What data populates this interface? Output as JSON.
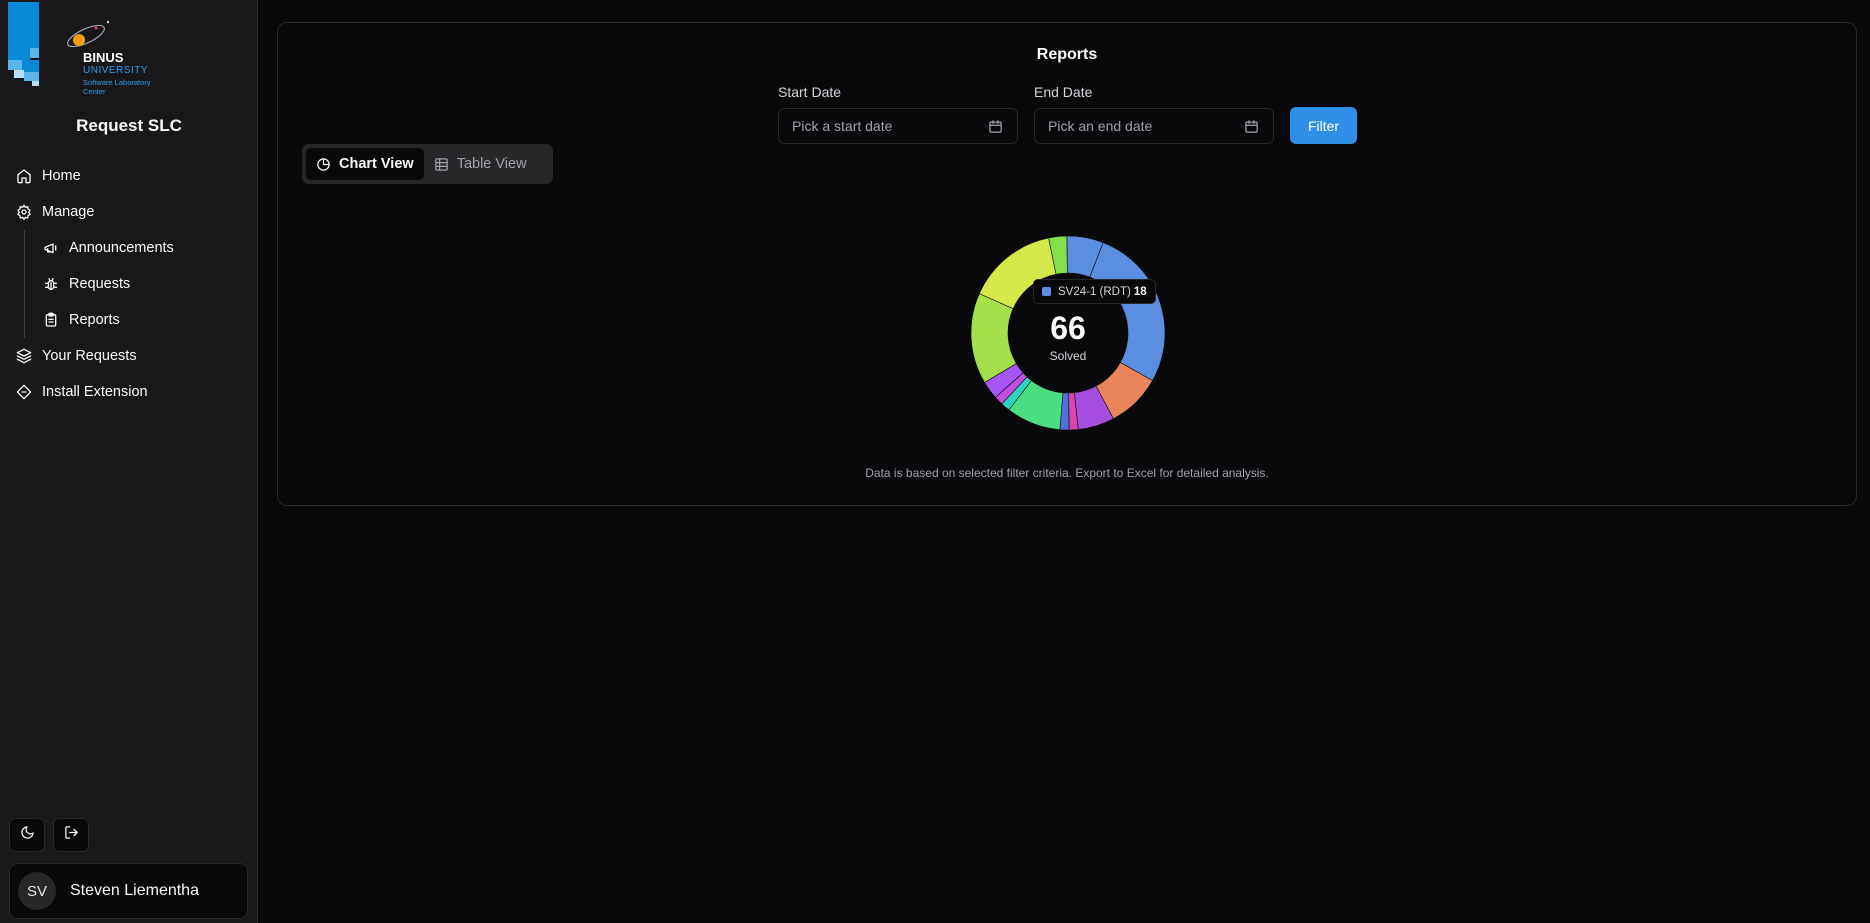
{
  "brand": {
    "logo_line1": "BINUS",
    "logo_line2": "UNIVERSITY",
    "logo_line3": "Software Laboratory",
    "logo_line4": "Center",
    "app_title": "Request SLC"
  },
  "sidebar": {
    "items": [
      {
        "label": "Home",
        "icon": "home-icon"
      },
      {
        "label": "Manage",
        "icon": "gear-icon"
      },
      {
        "label": "Announcements",
        "icon": "megaphone-icon"
      },
      {
        "label": "Requests",
        "icon": "bug-icon"
      },
      {
        "label": "Reports",
        "icon": "clipboard-icon"
      },
      {
        "label": "Your Requests",
        "icon": "layers-icon"
      },
      {
        "label": "Install Extension",
        "icon": "extension-icon"
      }
    ]
  },
  "user": {
    "initials": "SV",
    "name": "Steven Liementha"
  },
  "reports": {
    "title": "Reports",
    "start_label": "Start Date",
    "start_placeholder": "Pick a start date",
    "end_label": "End Date",
    "end_placeholder": "Pick an end date",
    "filter_label": "Filter",
    "chart_view_label": "Chart View",
    "table_view_label": "Table View",
    "footnote": "Data is based on selected filter criteria. Export to Excel for detailed analysis."
  },
  "chart_data": {
    "type": "pie",
    "center_value": "66",
    "center_label": "Solved",
    "values": [
      18,
      6,
      4,
      1,
      1,
      6,
      1,
      1,
      2,
      10,
      10,
      2,
      4
    ],
    "colors": [
      "#5b8ee0",
      "#e8845a",
      "#a64ee0",
      "#d946a8",
      "#4f70e0",
      "#4ade80",
      "#2dd4bf",
      "#c04ee0",
      "#a855f7",
      "#a3e04a",
      "#d4e84a",
      "#84e04a",
      "#5b8ee0"
    ],
    "tooltip": {
      "label": "SV24-1 (RDT)",
      "value": "18",
      "color": "#5b8ee0"
    }
  },
  "colors": {
    "accent": "#2f8ee6",
    "background": "#09090b",
    "sidebar": "#18181b"
  }
}
